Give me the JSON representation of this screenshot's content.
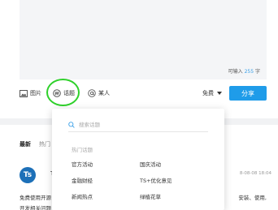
{
  "composer": {
    "counter_prefix": "可输入",
    "counter_value": "255",
    "counter_suffix": "字"
  },
  "toolbar": {
    "image_label": "图片",
    "topic_label": "话题",
    "mention_label": "某人",
    "visibility_label": "免费",
    "share_label": "分享"
  },
  "feed": {
    "tab_latest": "最新",
    "tab_hot": "热门",
    "post": {
      "avatar_text": "Ts",
      "name_fragment": "T",
      "time_fragment": "8-08-08 18:04",
      "line1_left": "免费使用开源",
      "line1_right": "安装、使用,",
      "line2_left": "开发相关问题"
    }
  },
  "topic_popup": {
    "search_placeholder": "搜索话题",
    "hot_title": "热门话题",
    "topics": [
      "官方活动",
      "国庆活动",
      "金融财经",
      "TS+优化意见",
      "新闻热点",
      "绿植花草"
    ]
  },
  "colors": {
    "accent": "#1f9ce9",
    "highlight": "#2fd12b"
  }
}
